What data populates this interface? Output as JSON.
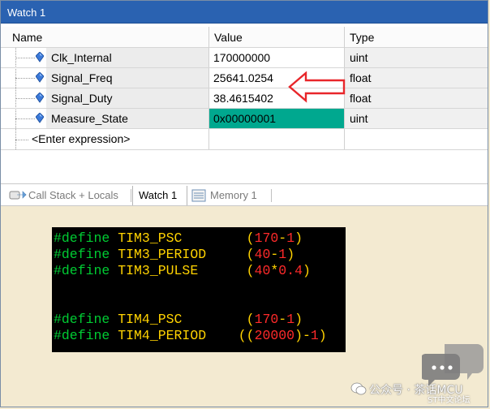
{
  "window": {
    "title": "Watch 1"
  },
  "columns": {
    "name": "Name",
    "value": "Value",
    "type": "Type"
  },
  "rows": [
    {
      "name": "Clk_Internal",
      "value": "170000000",
      "type": "uint",
      "highlight": false
    },
    {
      "name": "Signal_Freq",
      "value": "25641.0254",
      "type": "float",
      "highlight": false
    },
    {
      "name": "Signal_Duty",
      "value": "38.4615402",
      "type": "float",
      "highlight": false
    },
    {
      "name": "Measure_State",
      "value": "0x00000001",
      "type": "uint",
      "highlight": true
    }
  ],
  "enter_expression": "<Enter expression>",
  "tabs": [
    {
      "label": "Call Stack + Locals",
      "icon": "call-stack-icon",
      "active": false
    },
    {
      "label": "Watch 1",
      "icon": "",
      "active": true
    },
    {
      "label": "Memory 1",
      "icon": "memory-icon",
      "active": false
    }
  ],
  "code": [
    [
      {
        "t": "#define ",
        "c": "kw"
      },
      {
        "t": "TIM3_PSC",
        "c": "id"
      },
      {
        "t": "        ",
        "c": "kw"
      },
      {
        "t": "(",
        "c": "paren"
      },
      {
        "t": "170",
        "c": "num"
      },
      {
        "t": "-",
        "c": "op"
      },
      {
        "t": "1",
        "c": "num"
      },
      {
        "t": ")",
        "c": "paren"
      }
    ],
    [
      {
        "t": "#define ",
        "c": "kw"
      },
      {
        "t": "TIM3_PERIOD",
        "c": "id"
      },
      {
        "t": "     ",
        "c": "kw"
      },
      {
        "t": "(",
        "c": "paren"
      },
      {
        "t": "40",
        "c": "num"
      },
      {
        "t": "-",
        "c": "op"
      },
      {
        "t": "1",
        "c": "num"
      },
      {
        "t": ")",
        "c": "paren"
      }
    ],
    [
      {
        "t": "#define ",
        "c": "kw"
      },
      {
        "t": "TIM3_PULSE",
        "c": "id"
      },
      {
        "t": "      ",
        "c": "kw"
      },
      {
        "t": "(",
        "c": "paren"
      },
      {
        "t": "40",
        "c": "num"
      },
      {
        "t": "*",
        "c": "op"
      },
      {
        "t": "0.4",
        "c": "num"
      },
      {
        "t": ")",
        "c": "paren"
      }
    ],
    [],
    [],
    [
      {
        "t": "#define ",
        "c": "kw"
      },
      {
        "t": "TIM4_PSC",
        "c": "id"
      },
      {
        "t": "        ",
        "c": "kw"
      },
      {
        "t": "(",
        "c": "paren"
      },
      {
        "t": "170",
        "c": "num"
      },
      {
        "t": "-",
        "c": "op"
      },
      {
        "t": "1",
        "c": "num"
      },
      {
        "t": ")",
        "c": "paren"
      }
    ],
    [
      {
        "t": "#define ",
        "c": "kw"
      },
      {
        "t": "TIM4_PERIOD",
        "c": "id"
      },
      {
        "t": "    ",
        "c": "kw"
      },
      {
        "t": "((",
        "c": "paren"
      },
      {
        "t": "20000",
        "c": "num"
      },
      {
        "t": ")",
        "c": "paren"
      },
      {
        "t": "-",
        "c": "op"
      },
      {
        "t": "1",
        "c": "num"
      },
      {
        "t": ")",
        "c": "paren"
      }
    ]
  ],
  "watermark": {
    "text": "公众号 · 茶话MCU",
    "sub": "ST中文论坛"
  },
  "colors": {
    "title_bar": "#2a62b1",
    "highlight_value": "#00a88f",
    "arrow": "#e8262a",
    "background": "#f3ead1",
    "code_bg": "#000000"
  }
}
